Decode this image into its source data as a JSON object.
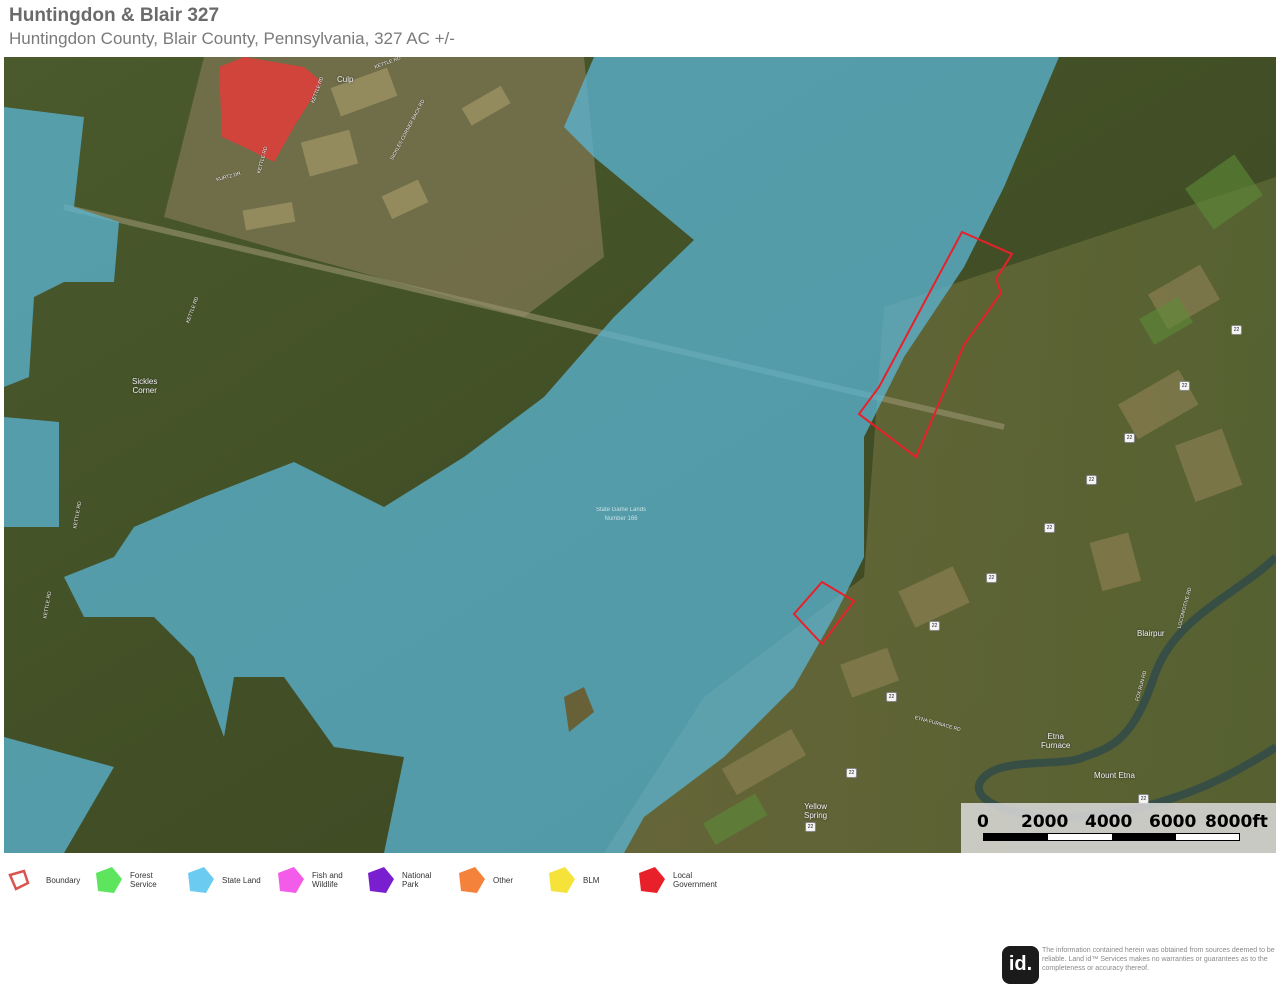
{
  "header": {
    "title": "Huntingdon & Blair 327",
    "subtitle": "Huntingdon County, Blair County, Pennsylvania, 327 AC +/-"
  },
  "map": {
    "place_labels": {
      "culp": "Culp",
      "sickles_corner": "Sickles\nCorner",
      "blairpur": "Blairpur",
      "etna_furnace": "Etna\nFurnace",
      "mount_etna": "Mount Etna",
      "yellow_spring": "Yellow\nSpring",
      "state_game_lands": "State Game Lands\nNumber 166"
    },
    "road_labels": {
      "kettle_rd_1": "KETTLE RD",
      "kettle_rd_2": "KETTLE RD",
      "kettle_rd_3": "KETTLE RD",
      "kettle_rd_4": "KETTLE RD",
      "kettle_rd_5": "KETTLE RD",
      "kettle_rd_6": "KETTLE RD",
      "kurtz_dr": "KURTZ DR",
      "sickles_corner_back_rd": "SICKLES CORNER BACK RD",
      "etna_furnace_rd": "ETNA FURNACE RD",
      "fox_run_rd": "FOX RUN RD",
      "locomotive_rd": "LOCOMOTIVE RD"
    },
    "route_shields": [
      "22",
      "22",
      "22",
      "22",
      "22",
      "22",
      "22",
      "22",
      "22",
      "22",
      "22"
    ],
    "colors": {
      "boundary": "#e8202a",
      "state_land": "#5bb6d6",
      "local_government": "#e83a3a"
    }
  },
  "scale": {
    "labels": [
      "0",
      "2000",
      "4000",
      "6000",
      "8000ft"
    ]
  },
  "legend": [
    {
      "name": "boundary",
      "label": "Boundary",
      "color": "#d9534f",
      "icon": "outline-polygon-icon"
    },
    {
      "name": "forest-service",
      "label": "Forest Service",
      "color": "#5de65d",
      "icon": "polygon-icon"
    },
    {
      "name": "state-land",
      "label": "State Land",
      "color": "#6ccbf0",
      "icon": "polygon-icon"
    },
    {
      "name": "fish-wildlife",
      "label": "Fish and Wildlife",
      "color": "#f25ce8",
      "icon": "polygon-icon"
    },
    {
      "name": "national-park",
      "label": "National Park",
      "color": "#7a1fcf",
      "icon": "polygon-icon"
    },
    {
      "name": "other",
      "label": "Other",
      "color": "#f5823a",
      "icon": "polygon-icon"
    },
    {
      "name": "blm",
      "label": "BLM",
      "color": "#f5e33a",
      "icon": "polygon-icon"
    },
    {
      "name": "local-government",
      "label": "Local Government",
      "color": "#e8202a",
      "icon": "polygon-icon"
    }
  ],
  "footer": {
    "logo_text": "id.",
    "disclaimer": "The information contained herein was obtained from sources deemed to be reliable. Land id™ Services makes no warranties or guarantees as to the completeness or accuracy thereof."
  }
}
